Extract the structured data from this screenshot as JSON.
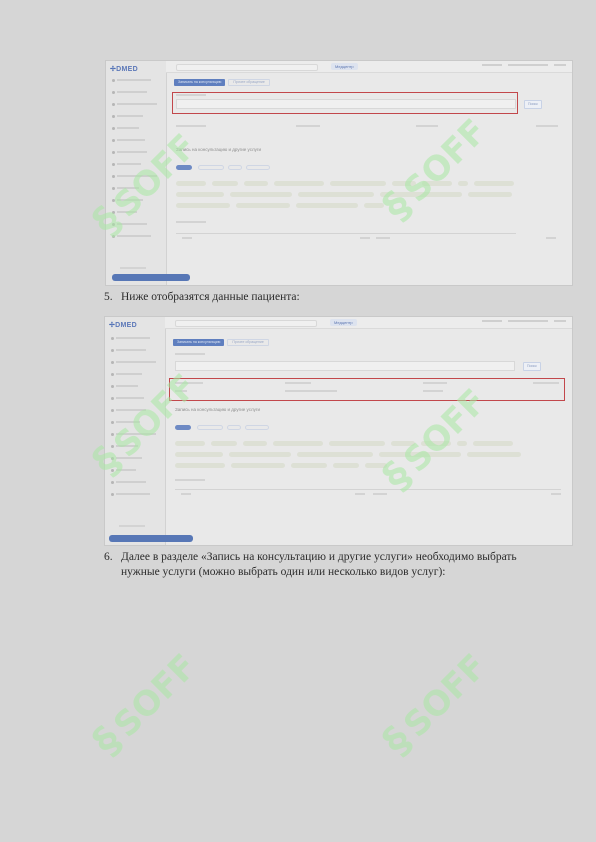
{
  "screenshot1": {
    "logo": "DMED",
    "hospital_label": "Медцентр",
    "tabs": [
      "Записать на консультацию",
      "Прочее обращение"
    ],
    "section_title": "Запись на консультацию и другие услуги",
    "service_tabs": [
      "Услуги",
      "Диагностика",
      "ЛПУ",
      "Процедуры"
    ]
  },
  "item5": {
    "number": "5.",
    "text": "Ниже отобразятся данные пациента:"
  },
  "screenshot2": {
    "logo": "DMED",
    "hospital_label": "Медцентр",
    "tabs": [
      "Записать на консультацию",
      "Прочее обращение"
    ],
    "section_title": "Запись на консультацию и другие услуги",
    "service_tabs": [
      "Услуги",
      "Диагностика",
      "ЛПУ",
      "Процедуры"
    ]
  },
  "item6": {
    "number": "6.",
    "line1": "Далее в разделе «Запись на консультацию и другие услуги» необходимо выбрать",
    "line2": "нужные услуги (можно выбрать один или несколько видов услуг):"
  },
  "watermark": {
    "text": "SOFF",
    "color": "#a9e8a4"
  },
  "colors": {
    "highlight": "#c2474b",
    "accent": "#5f7fbf"
  }
}
